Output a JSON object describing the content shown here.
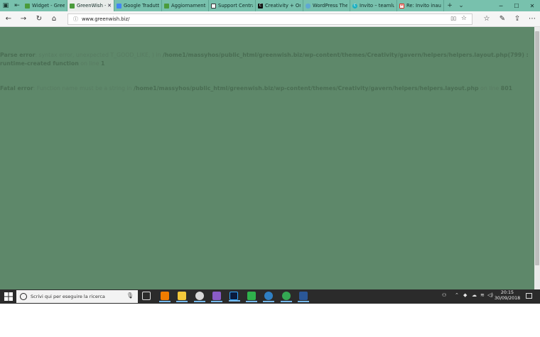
{
  "browser": {
    "tabs": [
      {
        "title": "Widget - GreenV",
        "fav_color": "#4a9b3b",
        "active": false
      },
      {
        "title": "GreenWish –",
        "fav_color": "#4a9b3b",
        "active": true
      },
      {
        "title": "Google Tradutto",
        "fav_color": "#4285f4",
        "active": false
      },
      {
        "title": "Aggiornamenti c",
        "fav_color": "#4a9b3b",
        "active": false
      },
      {
        "title": "Support Central",
        "fav_color": "#ffffff",
        "active": false
      },
      {
        "title": "Creativity + One",
        "fav_color": "#111111",
        "active": false
      },
      {
        "title": "WordPress Then",
        "fav_color": "#5fa8d3",
        "active": false
      },
      {
        "title": "Invito – teamlun",
        "fav_color": "#1ab0c2",
        "active": false
      },
      {
        "title": "Re: Invito inaugu",
        "fav_color": "#d93025",
        "active": false
      }
    ],
    "url": "www.greenwish.biz/"
  },
  "page": {
    "errors": [
      {
        "label": "Parse error",
        "message": ": syntax error, unexpected T_GOOD_LIKE, ) in ",
        "path": "/home1/massyhos/public_html/greenwish.biz/wp-content/themes/Creativity/gavern/helpers/helpers.layout.php(799) : runtime-created function",
        "line_text": " on line ",
        "line": "1"
      },
      {
        "label": "Fatal error",
        "message": ": Function name must be a string in ",
        "path": "/home1/massyhos/public_html/greenwish.biz/wp-content/themes/Creativity/gavern/helpers/helpers.layout.php",
        "line_text": " on line ",
        "line": "801"
      }
    ]
  },
  "taskbar": {
    "search_placeholder": "Scrivi qui per eseguire la ricerca",
    "time": "20:15",
    "date": "30/09/2018"
  },
  "colors": {
    "tab_strip": "#78c1ad",
    "page_background": "#5e886a",
    "taskbar": "#2b2b2b"
  }
}
